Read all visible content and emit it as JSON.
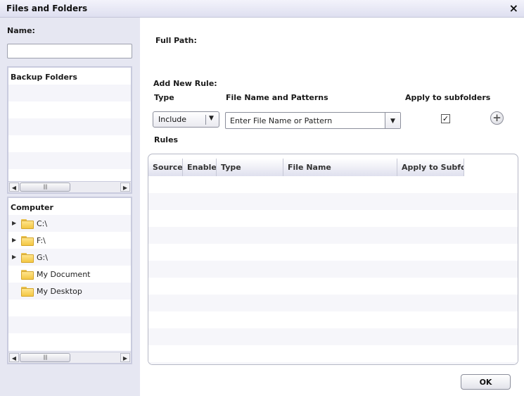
{
  "window": {
    "title": "Files and Folders",
    "close_icon": "×"
  },
  "left": {
    "name_label": "Name:",
    "name_value": "",
    "backup_panel": {
      "title": "Backup Folders"
    },
    "computer_panel": {
      "title": "Computer",
      "items": [
        {
          "label": "C:\\",
          "expandable": true
        },
        {
          "label": "F:\\",
          "expandable": true
        },
        {
          "label": "G:\\",
          "expandable": true
        },
        {
          "label": "My Document",
          "expandable": false
        },
        {
          "label": "My Desktop",
          "expandable": false
        }
      ]
    },
    "scroll_glyphs": {
      "left": "◀",
      "right": "▶",
      "grip": "||||"
    }
  },
  "right": {
    "full_path_label": "Full Path:",
    "add_rule_label": "Add New Rule:",
    "type_label": "Type",
    "pattern_label": "File Name and Patterns",
    "subfolders_label": "Apply to subfolders",
    "type_value": "Include",
    "pattern_placeholder": "Enter File Name or Pattern",
    "dropdown_glyph": "▼",
    "check_glyph": "✓",
    "add_glyph": "+",
    "apply_subfolders_checked": true,
    "rules_label": "Rules",
    "columns": [
      "Source",
      "Enable",
      "Type",
      "File Name",
      "Apply to Subfolders"
    ],
    "ok_label": "OK"
  }
}
